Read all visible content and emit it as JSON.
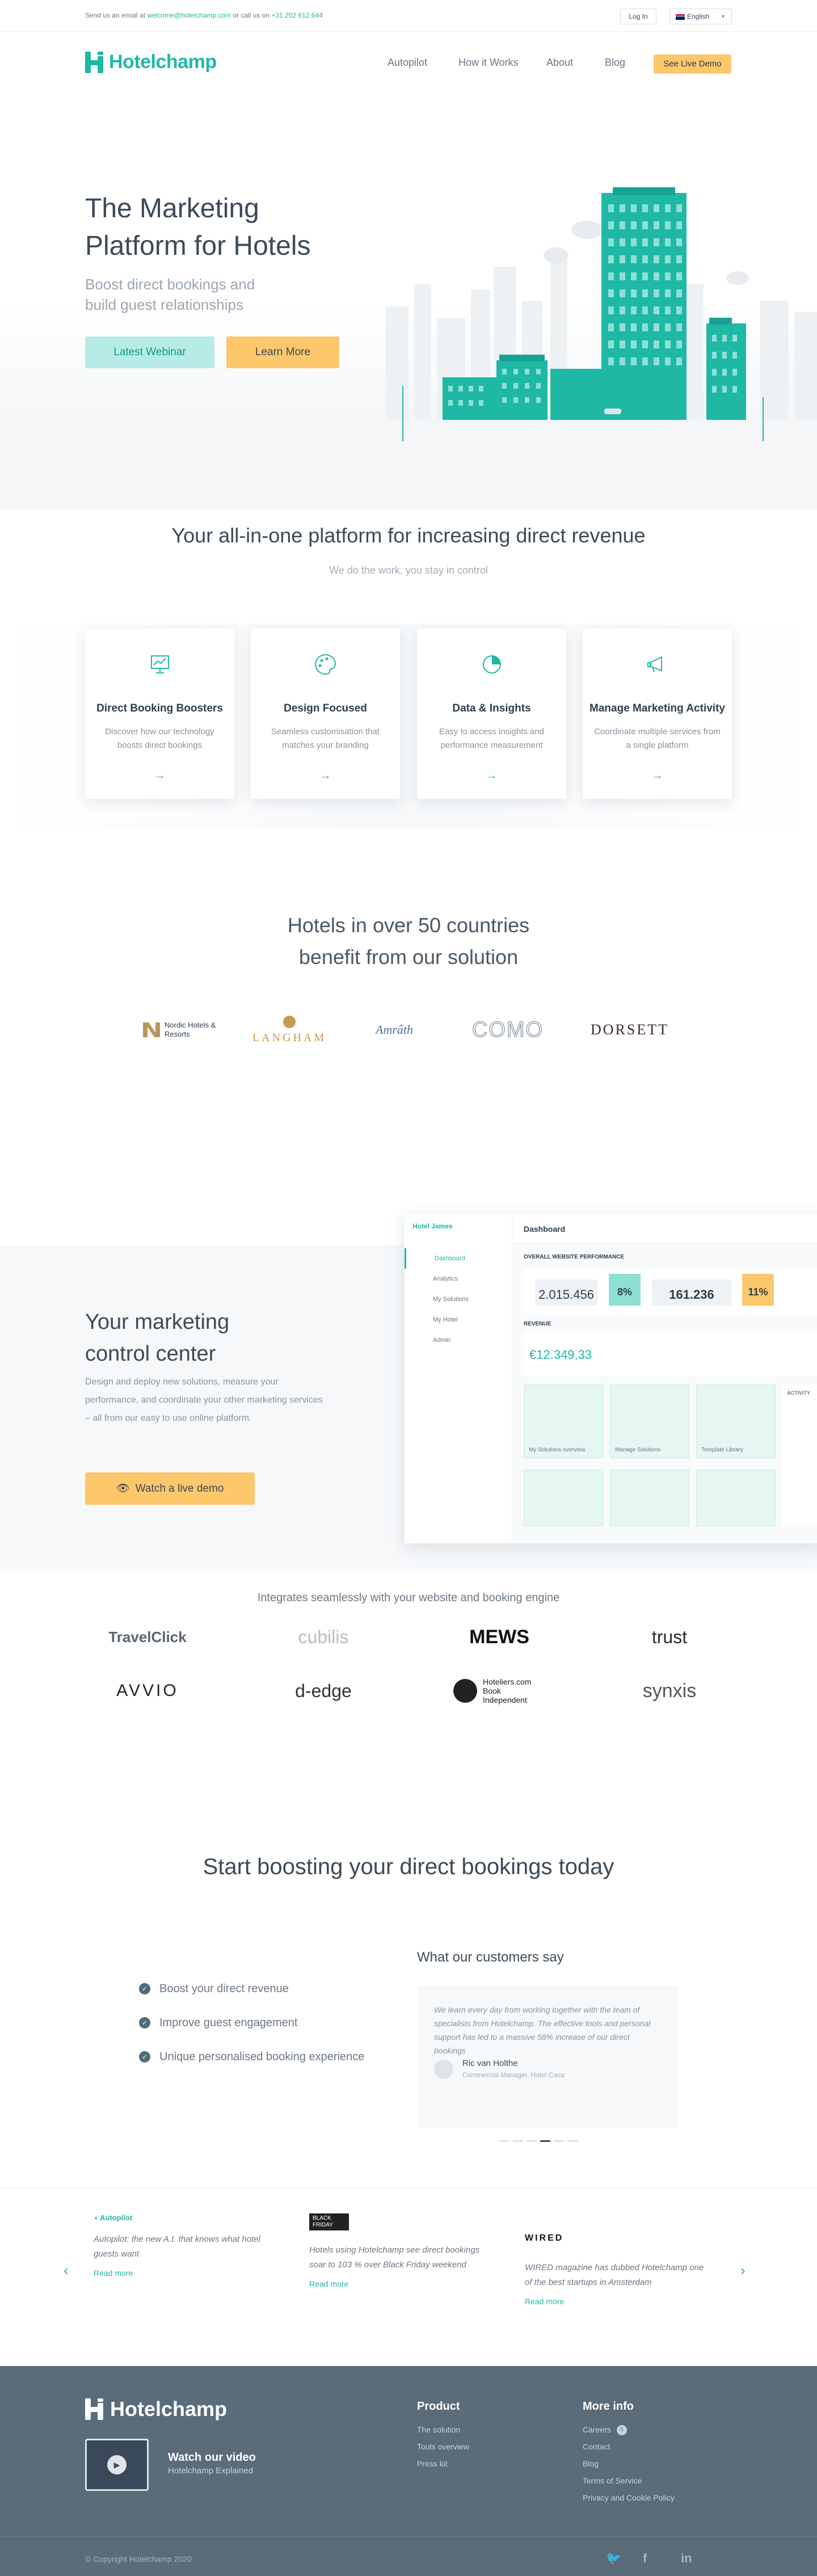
{
  "topbar": {
    "prefix": "Send us an email at ",
    "email": "welcome@hotelchamp.com",
    "mid": " or call us on ",
    "phone": "+31 202 612 644",
    "login": "Log In",
    "language": "English"
  },
  "nav": {
    "brand": "Hotelchamp",
    "links": [
      "Autopilot",
      "How it Works",
      "About",
      "Blog"
    ],
    "demo": "See Live Demo"
  },
  "hero": {
    "title_line1": "The Marketing",
    "title_line2": "Platform for Hotels",
    "sub_line1": "Boost direct bookings and",
    "sub_line2": "build guest relationships",
    "btn_webinar": "Latest Webinar",
    "btn_more": "Learn More"
  },
  "platform": {
    "title": "Your all-in-one platform for increasing direct revenue",
    "subtitle": "We do the work, you stay in control",
    "cards": [
      {
        "title": "Direct Booking Boosters",
        "text": "Discover how our technology boosts direct bookings",
        "icon": "chart-board-icon"
      },
      {
        "title": "Design Focused",
        "text": "Seamless customisation that matches your branding",
        "icon": "palette-icon"
      },
      {
        "title": "Data & Insights",
        "text": "Easy to access insights and performance measurement",
        "icon": "pie-chart-icon"
      },
      {
        "title": "Manage Marketing Activity",
        "text": "Coordinate multiple services from a single platform",
        "icon": "megaphone-icon"
      }
    ]
  },
  "hotels": {
    "line1": "Hotels in over 50 countries",
    "line2": "benefit from our solution",
    "logos": [
      "Nordic Hotels & Resorts",
      "LANGHAM",
      "Amrâth",
      "COMO",
      "DORSETT"
    ]
  },
  "control": {
    "title_line1": "Your marketing",
    "title_line2": "control center",
    "text": "Design and deploy new solutions, measure your performance, and coordinate your other marketing services – all from our easy to use online platform.",
    "button": "Watch a live demo",
    "dashboard": {
      "hotel": "Hotel James",
      "title": "Dashboard",
      "menu": [
        "Dashboard",
        "Analytics",
        "My Solutions",
        "My Hotel",
        "Admin"
      ],
      "perf_label": "OVERALL WEBSITE PERFORMANCE",
      "stats": [
        "2.015.456",
        "8%",
        "161.236",
        "11%"
      ],
      "revenue_label": "REVENUE",
      "revenue": "€12.349,33",
      "tiles": [
        "My Solutions overview",
        "Manage Solutions",
        "Template Library"
      ],
      "activity": "ACTIVITY"
    }
  },
  "integrations": {
    "title": "Integrates seamlessly with your website and booking engine",
    "logos": [
      "TravelClick",
      "cubilis",
      "MEWS",
      "trust",
      "AVVIO",
      "d-edge",
      "Hoteliers.com Book Independent",
      "synxis"
    ]
  },
  "boost": {
    "title": "Start boosting your direct bookings today",
    "checks": [
      "Boost your direct revenue",
      "Improve guest engagement",
      "Unique personalised booking experience"
    ],
    "testimonial_title": "What our customers say",
    "quote": "We learn every day from working together with the team of specialists from Hotelchamp. The effective tools and personal support has led to a massive 58% increase of our direct bookings",
    "name": "Ric van Holthe",
    "role": "Commercial Manager, Hotel Casa"
  },
  "press": {
    "items": [
      {
        "source": "Autopilot",
        "text": "Autopilot: the new A.I. that knows what hotel guests want",
        "link": "Read more"
      },
      {
        "source": "BLACK FRIDAY",
        "text": "Hotels using Hotelchamp see direct bookings soar to 103 % over Black Friday weekend",
        "link": "Read more"
      },
      {
        "source": "WIRED",
        "text": "WIRED magazine has dubbed Hotelchamp one of the best startups in Amsterdam",
        "link": "Read more"
      }
    ]
  },
  "footer": {
    "brand": "Hotelchamp",
    "video_title": "Watch our video",
    "video_sub": "Hotelchamp Explained",
    "product_title": "Product",
    "product_links": [
      "The solution",
      "Tools overview",
      "Press kit"
    ],
    "more_title": "More info",
    "more_links": [
      "Careers",
      "Contact",
      "Blog",
      "Terms of Service",
      "Privacy and Cookie Policy"
    ],
    "careers_badge": "5",
    "copyright": "© Copyright Hotelchamp 2020"
  },
  "colors": {
    "teal": "#1fb8a5",
    "yellow": "#fdc76b",
    "footer": "#5a6b7a"
  }
}
